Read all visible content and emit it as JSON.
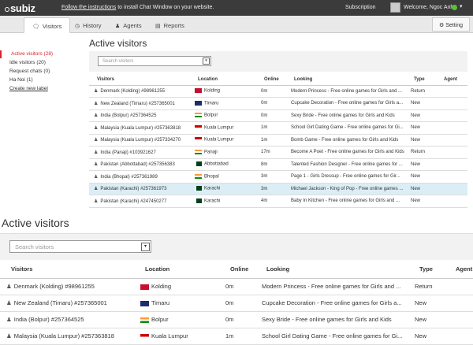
{
  "topbar": {
    "logo": "subiz",
    "message_link": "Follow the instructions",
    "message_rest": " to install Chat Window on your website.",
    "subscription": "Subscription",
    "welcome": "Welcome, Ngoc Anh"
  },
  "nav": {
    "tabs": [
      {
        "label": "Visitors",
        "icon": "chat-icon"
      },
      {
        "label": "History",
        "icon": "clock-icon"
      },
      {
        "label": "Agents",
        "icon": "person-icon"
      },
      {
        "label": "Reports",
        "icon": "chart-icon"
      }
    ],
    "setting": "Setting"
  },
  "sidebar": {
    "items": [
      "Active visitors (28)",
      "Idle visitors (20)",
      "Request chats (0)",
      "Ha Noi (1)",
      "Create new label"
    ]
  },
  "panel": {
    "title": "Active visitors",
    "search_placeholder": "Search visitors"
  },
  "table": {
    "headers": [
      "Visitors",
      "Location",
      "Online",
      "Looking",
      "Type",
      "Agent"
    ],
    "rows": [
      {
        "visitor": "Denmark (Kolding) #98961255",
        "location": "Kolding",
        "online": "0m",
        "looking": "Modern Princess - Free online games for Girls and ...",
        "type": "Return"
      },
      {
        "visitor": "New Zealand (Timaru) #257365001",
        "location": "Timaru",
        "online": "0m",
        "looking": "Cupcake Decoration - Free online games for Girls a...",
        "type": "New"
      },
      {
        "visitor": "India (Bolpur) #257364525",
        "location": "Bolpur",
        "online": "0m",
        "looking": "Sexy Bride - Free online games for Girls and Kids",
        "type": "New"
      },
      {
        "visitor": "Malaysia (Kuala Lumpur) #257363818",
        "location": "Kuala Lumpur",
        "online": "1m",
        "looking": "School Girl Dating Game - Free online games for Gi...",
        "type": "New"
      },
      {
        "visitor": "Malaysia (Kuala Lumpur) #257334270",
        "location": "Kuala Lumpur",
        "online": "1m",
        "looking": "Bomb Game - Free online games for Girls and Kids",
        "type": "New"
      },
      {
        "visitor": "India (Panaji) #103921627",
        "location": "Panaji",
        "online": "17m",
        "looking": "Become A Poet - Free online games for Girls and Kids",
        "type": "Return"
      },
      {
        "visitor": "Pakistan (Abbottabad) #257356383",
        "location": "Abbottabad",
        "online": "8m",
        "looking": "Talented Fashion Designer - Free online games for ...",
        "type": "New"
      },
      {
        "visitor": "India (Bhopal) #257361989",
        "location": "Bhopal",
        "online": "3m",
        "looking": "Page 1 - Girls Dressup - Free online games for Gir...",
        "type": "New"
      },
      {
        "visitor": "Pakistan (Karachi) #257361973",
        "location": "Karachi",
        "online": "3m",
        "looking": "Michael Jackson - King of Pop - Free online games ...",
        "type": "New"
      },
      {
        "visitor": "Pakistan (Karachi) #247450277",
        "location": "Karachi",
        "online": "4m",
        "looking": "Baby In Kitchen - Free online games for Girls and ...",
        "type": "New"
      }
    ]
  },
  "zoom": {
    "title": "Active visitors",
    "search_placeholder": "Search visitors",
    "headers": [
      "Visitors",
      "Location",
      "Online",
      "Looking",
      "Type",
      "Agent"
    ],
    "rows": [
      {
        "visitor": "Denmark (Kolding) #98961255",
        "location": "Kolding",
        "online": "0m",
        "looking": "Modern Princess - Free online games for Girls and ...",
        "type": "Return"
      },
      {
        "visitor": "New Zealand (Timaru) #257365001",
        "location": "Timaru",
        "online": "0m",
        "looking": "Cupcake Decoration - Free online games for Girls a...",
        "type": "New"
      },
      {
        "visitor": "India (Bolpur) #257364525",
        "location": "Bolpur",
        "online": "0m",
        "looking": "Sexy Bride - Free online games for Girls and Kids",
        "type": "New"
      },
      {
        "visitor": "Malaysia (Kuala Lumpur) #257363818",
        "location": "Kuala Lumpur",
        "online": "1m",
        "looking": "School Girl Dating Game - Free online games for Gi...",
        "type": "New"
      }
    ]
  },
  "colors": {
    "topbar": "#3b3b3b",
    "accent": "#d8232a",
    "online": "#5cc035",
    "selected_row": "#dbeef5"
  }
}
